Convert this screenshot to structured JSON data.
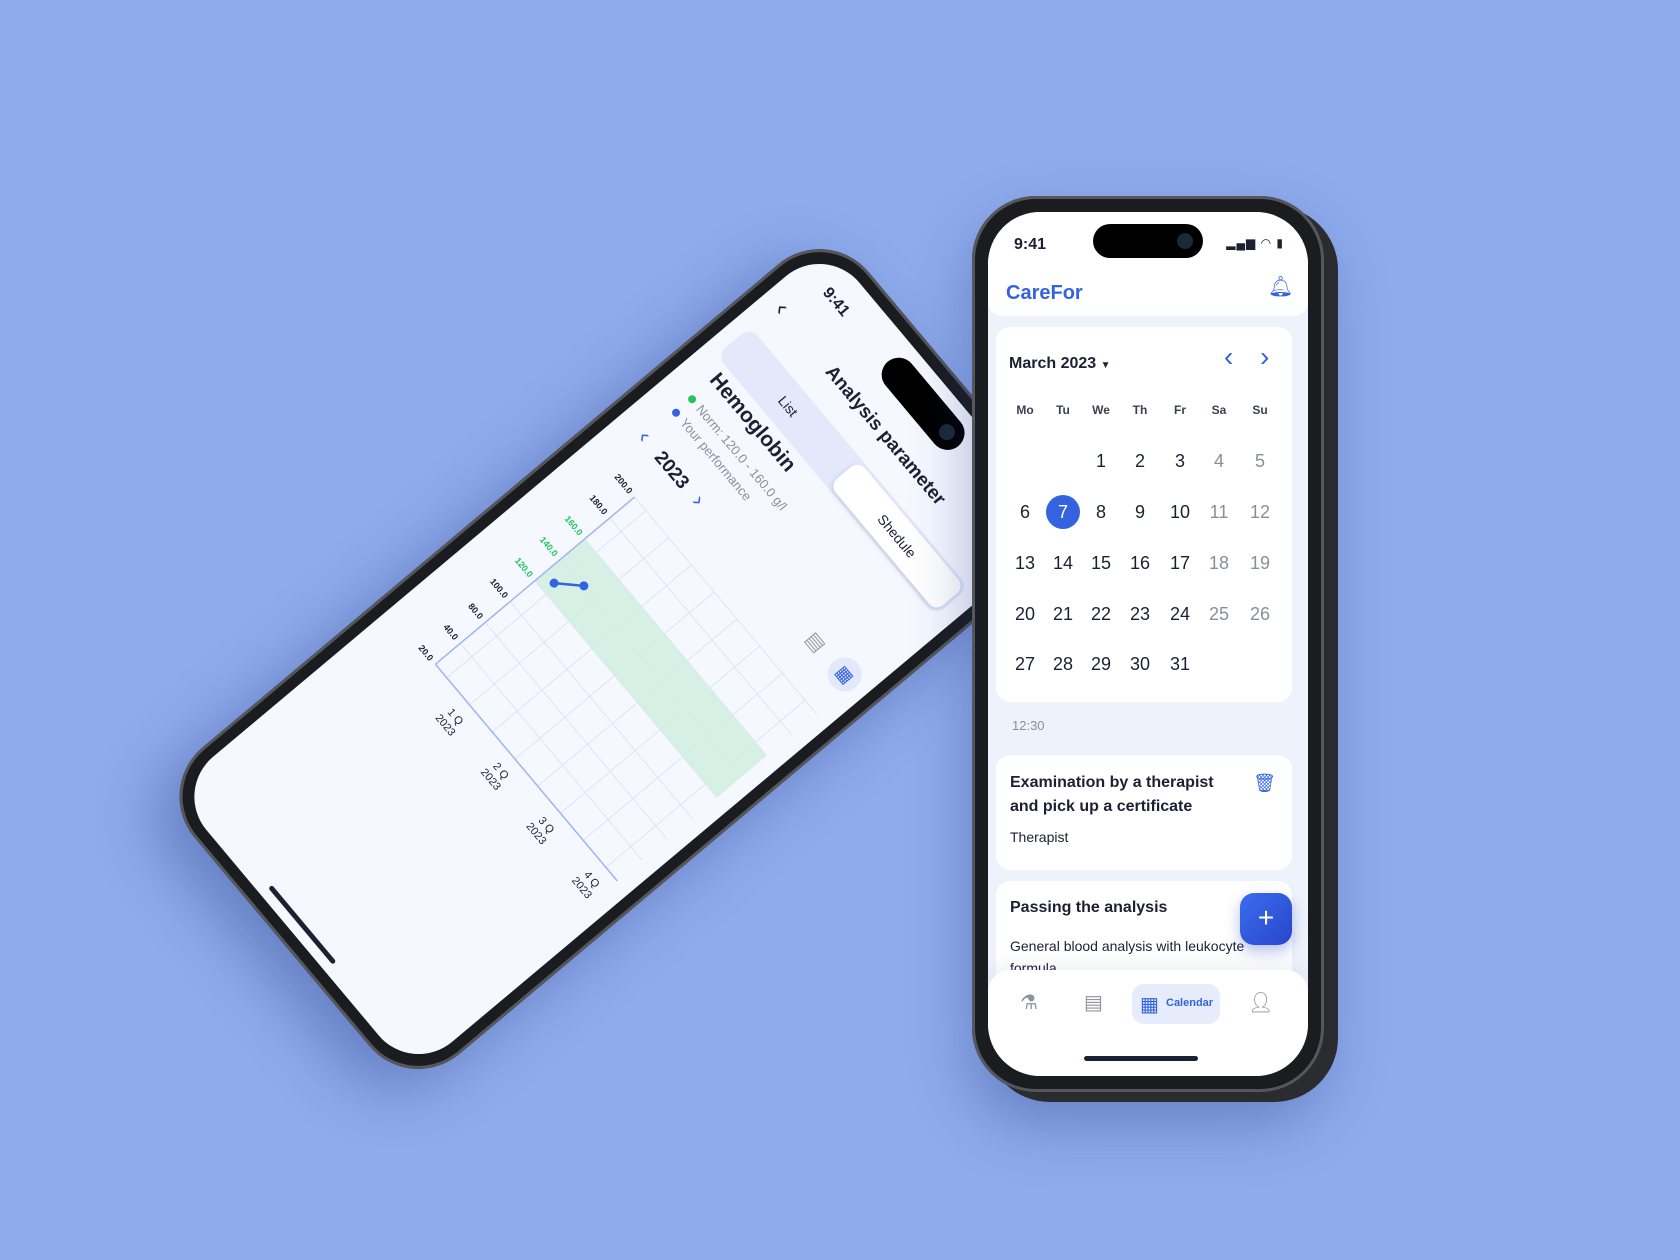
{
  "left_phone": {
    "status_time": "9:41",
    "title": "Analysis parameter",
    "tabs": [
      {
        "label": "List",
        "active": false
      },
      {
        "label": "Shedule",
        "active": true
      }
    ],
    "parameter": "Hemoglobin",
    "legend": [
      {
        "label": "Norm: 120.0 - 160.0 g/l",
        "color": "#22c55e"
      },
      {
        "label": "Your performance",
        "color": "#3563e0"
      }
    ],
    "year": "2023",
    "view_icons": [
      "list-icon",
      "calendar-icon"
    ],
    "chart_data": {
      "type": "line",
      "y_tick_labels": [
        "20.0",
        "40.0",
        "80.0",
        "100.0",
        "120.0",
        "140.0",
        "160.0",
        "180.0",
        "200.0"
      ],
      "x_tick_labels": [
        {
          "q": "1 Q",
          "year": "2023"
        },
        {
          "q": "2 Q",
          "year": "2023"
        },
        {
          "q": "3 Q",
          "year": "2023"
        },
        {
          "q": "4 Q",
          "year": "2023"
        }
      ],
      "norm_band": [
        120,
        160
      ],
      "points": [
        {
          "x": 0.45,
          "y": 128
        },
        {
          "x": 0.75,
          "y": 141
        }
      ],
      "xlim": [
        0.25,
        4.25
      ],
      "grid": true,
      "band_color": "#d3eee2",
      "line_color": "#3563e0"
    }
  },
  "right_phone": {
    "status_time": "9:41",
    "brand": "CareFor",
    "month": "March 2023",
    "weekdays": [
      "Mo",
      "Tu",
      "We",
      "Th",
      "Fr",
      "Sa",
      "Su"
    ],
    "weeks": [
      [
        "",
        "",
        "1",
        "2",
        "3",
        "4",
        "5"
      ],
      [
        "6",
        "7",
        "8",
        "9",
        "10",
        "11",
        "12"
      ],
      [
        "13",
        "14",
        "15",
        "16",
        "17",
        "18",
        "19"
      ],
      [
        "20",
        "21",
        "22",
        "23",
        "24",
        "25",
        "26"
      ],
      [
        "27",
        "28",
        "29",
        "30",
        "31",
        "",
        ""
      ]
    ],
    "selected_day": "7",
    "time_slot": "12:30",
    "events": [
      {
        "title_line1": "Examination by a therapist",
        "title_line2": "and pick up a certificate",
        "subtitle": "Therapist"
      },
      {
        "title": "Passing the analysis",
        "desc_line1": "General blood analysis with leukocyte",
        "desc_line2": "formula"
      }
    ],
    "nav": [
      {
        "icon": "microscope-icon"
      },
      {
        "icon": "analysis-list-icon"
      },
      {
        "icon": "calendar-icon",
        "label": "Calendar",
        "active": true
      },
      {
        "icon": "profile-icon"
      }
    ],
    "accent": "#3563e0"
  }
}
